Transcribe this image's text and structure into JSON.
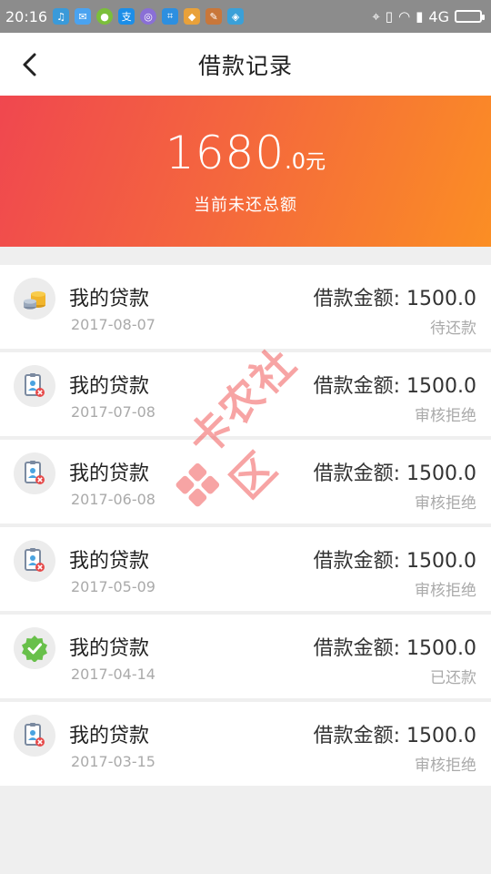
{
  "status_bar": {
    "time": "20:16",
    "network": "4G",
    "battery_level": 0.8,
    "notification_icons": [
      "headset-icon",
      "chat-icon",
      "circle-app-icon",
      "alipay-icon",
      "browser-icon",
      "scan-icon",
      "app-icon",
      "pen-icon",
      "map-icon"
    ]
  },
  "header": {
    "back_icon": "chevron-left-icon",
    "title": "借款记录"
  },
  "summary": {
    "amount_integer": "1680",
    "amount_decimal": ".0",
    "amount_unit": "元",
    "label": "当前未还总额",
    "gradient_start": "#f0474f",
    "gradient_end": "#fb8e24"
  },
  "records": [
    {
      "name": "我的贷款",
      "date": "2017-08-07",
      "amount_label": "借款金额: 1500.0",
      "status": "待还款",
      "icon": "coins-icon"
    },
    {
      "name": "我的贷款",
      "date": "2017-07-08",
      "amount_label": "借款金额: 1500.0",
      "status": "审核拒绝",
      "icon": "rejected-id-icon"
    },
    {
      "name": "我的贷款",
      "date": "2017-06-08",
      "amount_label": "借款金额: 1500.0",
      "status": "审核拒绝",
      "icon": "rejected-id-icon"
    },
    {
      "name": "我的贷款",
      "date": "2017-05-09",
      "amount_label": "借款金额: 1500.0",
      "status": "审核拒绝",
      "icon": "rejected-id-icon"
    },
    {
      "name": "我的贷款",
      "date": "2017-04-14",
      "amount_label": "借款金额: 1500.0",
      "status": "已还款",
      "icon": "check-badge-icon"
    },
    {
      "name": "我的贷款",
      "date": "2017-03-15",
      "amount_label": "借款金额: 1500.0",
      "status": "审核拒绝",
      "icon": "rejected-id-icon"
    }
  ],
  "watermark": {
    "text": "卡农社区"
  }
}
